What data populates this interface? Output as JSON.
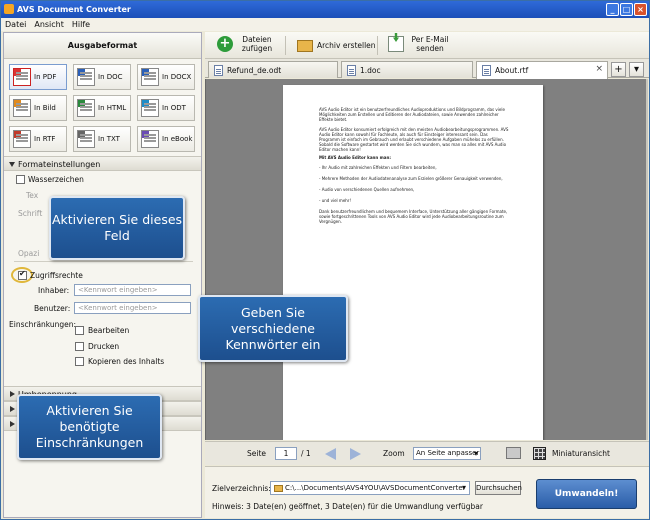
{
  "window": {
    "title": "AVS Document Converter"
  },
  "menu": [
    "Datei",
    "Ansicht",
    "Hilfe"
  ],
  "left": {
    "title": "Ausgabeformat",
    "formats": [
      {
        "label": "In PDF",
        "icon": "pdf",
        "selected": true
      },
      {
        "label": "In DOC",
        "icon": "doc"
      },
      {
        "label": "In DOCX",
        "icon": "doc"
      },
      {
        "label": "In Bild",
        "icon": "bild"
      },
      {
        "label": "In HTML",
        "icon": "html"
      },
      {
        "label": "In ODT",
        "icon": "odt"
      },
      {
        "label": "In RTF",
        "icon": "rtf"
      },
      {
        "label": "In TXT",
        "icon": "txt"
      },
      {
        "label": "In eBook",
        "icon": "ebook"
      }
    ],
    "settings": {
      "header": "Formateinstellungen",
      "wasserzeichen": "Wasserzeichen",
      "tex_partial": "Tex",
      "schrift_partial": "Schrift",
      "opaz_partial": "Opazi",
      "zugriffsrechte": "Zugriffsrechte",
      "inhaber_label": "Inhaber:",
      "inhaber_placeholder": "<Kennwort eingeben>",
      "benutzer_label": "Benutzer:",
      "benutzer_placeholder": "<Kennwort eingeben>",
      "einschraenkungen_label": "Einschränkungen:",
      "bearbeiten": "Bearbeiten",
      "drucken": "Drucken",
      "kopieren": "Kopieren des Inhalts"
    },
    "collapsed_sections": [
      "Umbenennung"
    ]
  },
  "callouts": {
    "activate_field": "Aktivieren Sie dieses Feld",
    "passwords": "Geben Sie verschiedene Kennwörter ein",
    "restrictions": "Aktivieren Sie benötigte Einschränkungen"
  },
  "toolbar": {
    "add_files": "Dateien zufügen",
    "create_archive": "Archiv erstellen",
    "send_email": "Per E-Mail senden"
  },
  "tabs": [
    {
      "label": "Refund_de.odt"
    },
    {
      "label": "1.doc"
    },
    {
      "label": "About.rtf",
      "active": true
    }
  ],
  "tab_controls": {
    "add": "+",
    "menu": "▾"
  },
  "document": {
    "paragraphs": [
      "AVS Audio Editor ist ein benutzerfreundliches Audioproduktions und Bildprogramm, das viele Möglichkeiten zum Erstellen und Editieren der Audiodateien, sowie Anwenden zahlreicher Effekte bietet.",
      "AVS Audio Editor konsumiert erfolgreich mit den meisten Audiobearbeitungsprogrammen. AVS Audio Editor kann sowohl für Fachleute, als auch für Einsteiger interessant sein. Das Programm ist einfach im Gebrauch und erlaubt verschiedene Aufgaben mühelos zu erfüllen. Sobald die Software gestartet wird werden Sie sich wundern, was man so alles mit AVS Audio Editor machen kann!",
      "Mit AVS Audio Editor kann man:",
      "- Ihr Audio mit zahlreichen Effekten und Filtern bearbeiten,",
      "- Mehrere Methoden der Audiodatenanalyse zum Erzielen größerer Genauigkeit verwenden,",
      "- Audio von verschiedenen Quellen aufnehmen,",
      "- und viel mehr!",
      "Dank benutzerfreundlichem und bequemem Interface, Unterstützung aller gängigen Formate, sowie fortgeschrittenen Tools von AVS Audio Editor wird jede Audiobearbeitungsroutine zum Vergnügen."
    ]
  },
  "nav": {
    "seite_label": "Seite",
    "page_value": "1",
    "page_total": "/ 1",
    "zoom_label": "Zoom",
    "zoom_value": "An Seite anpasser",
    "thumbs_label": "Miniaturansicht"
  },
  "output": {
    "dir_label": "Zielverzeichnis:",
    "dir_value": "C:\\...\\Documents\\AVS4YOU\\AVSDocumentConverter",
    "browse_label": "Durchsuchen",
    "hint": "Hinweis: 3 Date(en) geöffnet, 3 Date(en) für die Umwandlung verfügbar",
    "convert_label": "Umwandeln!"
  }
}
